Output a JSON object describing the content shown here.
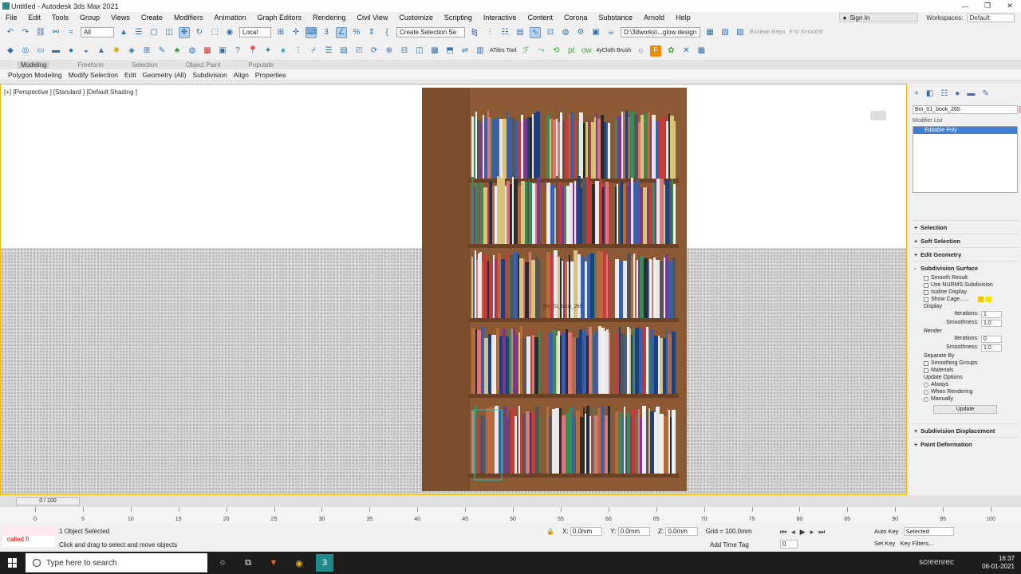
{
  "window": {
    "title": "Untitled - Autodesk 3ds Max 2021",
    "min": "—",
    "max": "❐",
    "close": "✕"
  },
  "menu": [
    "File",
    "Edit",
    "Tools",
    "Group",
    "Views",
    "Create",
    "Modifiers",
    "Animation",
    "Graph Editors",
    "Rendering",
    "Civil View",
    "Customize",
    "Scripting",
    "Interactive",
    "Content",
    "Corona",
    "Substance",
    "Arnold",
    "Help"
  ],
  "account": {
    "sign_in": "Sign In",
    "workspaces_label": "Workspaces:",
    "workspace": "Default"
  },
  "toolbar": {
    "selection_filter": "All",
    "ref_coord": "Local",
    "named_set": "Create Selection Se",
    "path": "D:\\3dworks\\...glow design",
    "boolean_repo": "Boolean Repo",
    "to_smooth": "E to Smoothit",
    "atiles": "ATiles Tool",
    "cloth_brush": "4yCloth Brush"
  },
  "ribbon_tabs": [
    "Modeling",
    "Freeform",
    "Selection",
    "Object Paint",
    "Populate"
  ],
  "ribbon_items": [
    "Polygon Modeling",
    "Modify Selection",
    "Edit",
    "Geometry (All)",
    "Subdivision",
    "Align",
    "Properties"
  ],
  "viewport": {
    "label": "[+] [Perspective ] [Standard ] [Default Shading ]",
    "object_tooltip": "Bm_01_book_265",
    "colors": {
      "frame": "#f5b800",
      "shelf": "#8b5a34"
    }
  },
  "command_panel": {
    "object_name": "Bm_01_book_265",
    "modifier_list": "Modifier List",
    "stack_item": "Editable Poly",
    "rollouts": {
      "selection": "Selection",
      "soft_selection": "Soft Selection",
      "edit_geometry": "Edit Geometry",
      "subdivision_surface": "Subdivision Surface",
      "subdivision_displacement": "Subdivision Displacement",
      "paint_deformation": "Paint Deformation"
    },
    "subdiv": {
      "smooth_result": "Smooth Result",
      "use_nurms": "Use NURMS Subdivision",
      "isoline": "Isoline Display",
      "show_cage": "Show Cage......",
      "display": "Display",
      "iterations_label": "Iterations:",
      "iterations": "1",
      "smoothness_label": "Smoothness:",
      "smoothness": "1.0",
      "render": "Render",
      "r_iterations": "0",
      "r_smoothness": "1.0",
      "separate_by": "Separate By",
      "smoothing_groups": "Smoothing Groups",
      "materials": "Materials",
      "update_options": "Update Options",
      "always": "Always",
      "when_rendering": "When Rendering",
      "manually": "Manually",
      "update": "Update"
    }
  },
  "timeline": {
    "slider": "0 / 100",
    "ticks": [
      "0",
      "5",
      "10",
      "15",
      "20",
      "25",
      "30",
      "35",
      "40",
      "45",
      "50",
      "55",
      "60",
      "65",
      "70",
      "75",
      "80",
      "85",
      "90",
      "95",
      "100"
    ]
  },
  "status": {
    "script_line": "called fi",
    "selected": "1 Object Selected",
    "prompt": "Click and drag to select and move objects",
    "x_label": "X:",
    "x": "0.0mm",
    "y_label": "Y:",
    "y": "0.0mm",
    "z_label": "Z:",
    "z": "0.0mm",
    "grid": "Grid = 100.0mm",
    "add_time_tag": "Add Time Tag",
    "frame": "0",
    "auto_key": "Auto Key",
    "selected_dd": "Selected",
    "set_key": "Set Key",
    "key_filters": "Key Filters..."
  },
  "taskbar": {
    "search": "Type here to search",
    "time": "16:37",
    "date": "06-01-2021",
    "screenrec": "screenrec"
  }
}
